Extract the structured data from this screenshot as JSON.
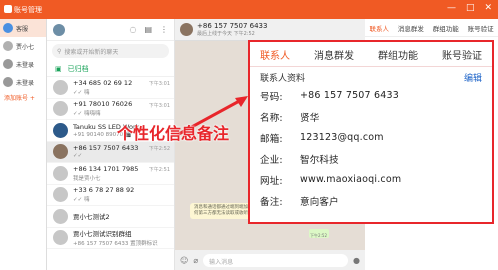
{
  "window": {
    "title": "账号管理",
    "controls": [
      "—",
      "□",
      "✕"
    ]
  },
  "accounts": {
    "items": [
      {
        "name": "客服"
      },
      {
        "name": "贾小七"
      },
      {
        "name": "未登录"
      },
      {
        "name": "未登录"
      }
    ],
    "add_label": "添加账号 +"
  },
  "chatlist": {
    "search_placeholder": "搜索或开始新的聊天",
    "archived_label": "已归档",
    "items": [
      {
        "name": "+34 685 02 69 12",
        "msg": "✓✓ 嗨",
        "time": "下午3:01"
      },
      {
        "name": "+91 78010 76026",
        "msg": "✓✓ 嗨嗨嗨",
        "time": "下午3:01"
      },
      {
        "name": "Tanuku SS LED Work",
        "msg": "+91 90140 89070 🎬",
        "time": ""
      },
      {
        "name": "+86 157 7507 6433",
        "msg": "✓✓",
        "time": "下午2:52"
      },
      {
        "name": "+86 134 1701 7985",
        "msg": "我是贾小七",
        "time": "下午2:51"
      },
      {
        "name": "+33 6 78 27 88 92",
        "msg": "✓✓ 嗨",
        "time": ""
      },
      {
        "name": "贾小七测试2",
        "msg": "",
        "time": ""
      },
      {
        "name": "贾小七测试识别群组",
        "msg": "+86 157 7507 6433 置顶群标识",
        "time": ""
      }
    ]
  },
  "chat": {
    "contact": "+86 157 7507 6433",
    "subtitle": "最后上线于今天 下午2:52",
    "system_tip": "消息和通话都通过端到端加密进行保护，任何第三方都无法读取或收听。",
    "bubble_time": "下午2:52",
    "input_placeholder": "输入消息"
  },
  "right_tabs": {
    "items": [
      "联系人",
      "消息群发",
      "群组功能",
      "账号验证"
    ],
    "active": 0
  },
  "panel": {
    "tabs": [
      "联系人",
      "消息群发",
      "群组功能",
      "账号验证"
    ],
    "active_tab": 0,
    "heading": "联系人资料",
    "edit_label": "编辑",
    "fields": [
      {
        "label": "号码:",
        "value": "+86 157 7507 6433"
      },
      {
        "label": "名称:",
        "value": "贤华"
      },
      {
        "label": "邮箱:",
        "value": "123123@qq.com"
      },
      {
        "label": "企业:",
        "value": "智尔科技"
      },
      {
        "label": "网址:",
        "value": "www.maoxiaoqi.com"
      },
      {
        "label": "备注:",
        "value": "意向客户"
      }
    ]
  },
  "annotation": {
    "text": "个性化信息备注"
  },
  "colors": {
    "accent": "#f05a24",
    "highlight": "#e8262b",
    "link": "#1e64c8"
  }
}
